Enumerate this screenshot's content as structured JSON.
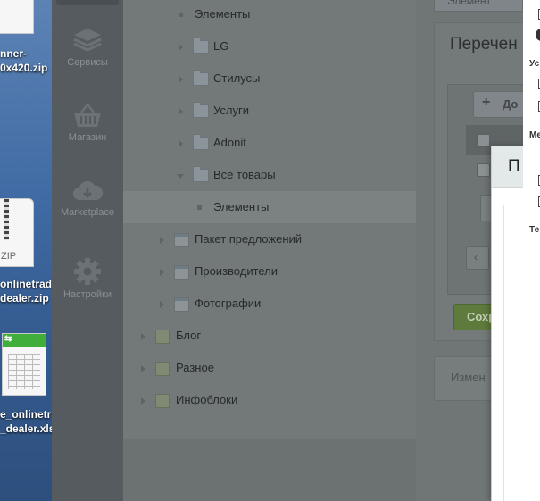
{
  "desktop": {
    "files": [
      {
        "label_lines": [
          "nner-",
          "0x420.zip"
        ]
      },
      {
        "badge": "ZIP",
        "label_lines": [
          "onlinetrad",
          "dealer.zip"
        ]
      },
      {
        "label_lines": [
          "e_onlinetr",
          "_dealer.xls"
        ]
      }
    ],
    "zip_text": "ZIP"
  },
  "sidebar": {
    "items": [
      {
        "label": "Сервисы",
        "icon": "stack-icon"
      },
      {
        "label": "Магазин",
        "icon": "basket-icon"
      },
      {
        "label": "Marketplace",
        "icon": "cloud-download-icon"
      },
      {
        "label": "Настройки",
        "icon": "gear-icon"
      }
    ]
  },
  "tree": {
    "items": [
      {
        "label": "Элементы",
        "kind": "element"
      },
      {
        "label": "LG",
        "kind": "folder"
      },
      {
        "label": "Стилусы",
        "kind": "folder"
      },
      {
        "label": "Услуги",
        "kind": "folder"
      },
      {
        "label": "Adonit",
        "kind": "folder"
      },
      {
        "label": "Все товары",
        "kind": "folder",
        "expanded": true
      },
      {
        "label": "Элементы",
        "kind": "element",
        "selected": true
      },
      {
        "label": "Пакет предложений",
        "kind": "iblock"
      },
      {
        "label": "Производители",
        "kind": "iblock"
      },
      {
        "label": "Фотографии",
        "kind": "iblock"
      },
      {
        "label": "Блог",
        "kind": "type"
      },
      {
        "label": "Разное",
        "kind": "type"
      },
      {
        "label": "Инфоблоки",
        "kind": "type"
      }
    ]
  },
  "content": {
    "tab_label": "Элемент",
    "title": "Перечен",
    "add_button": "До",
    "save_button": "Сохр",
    "change_button": "Измен"
  },
  "dialog": {
    "title": "П"
  },
  "right_strip": {
    "labels": [
      "Ус",
      "Ме",
      "Те"
    ]
  }
}
